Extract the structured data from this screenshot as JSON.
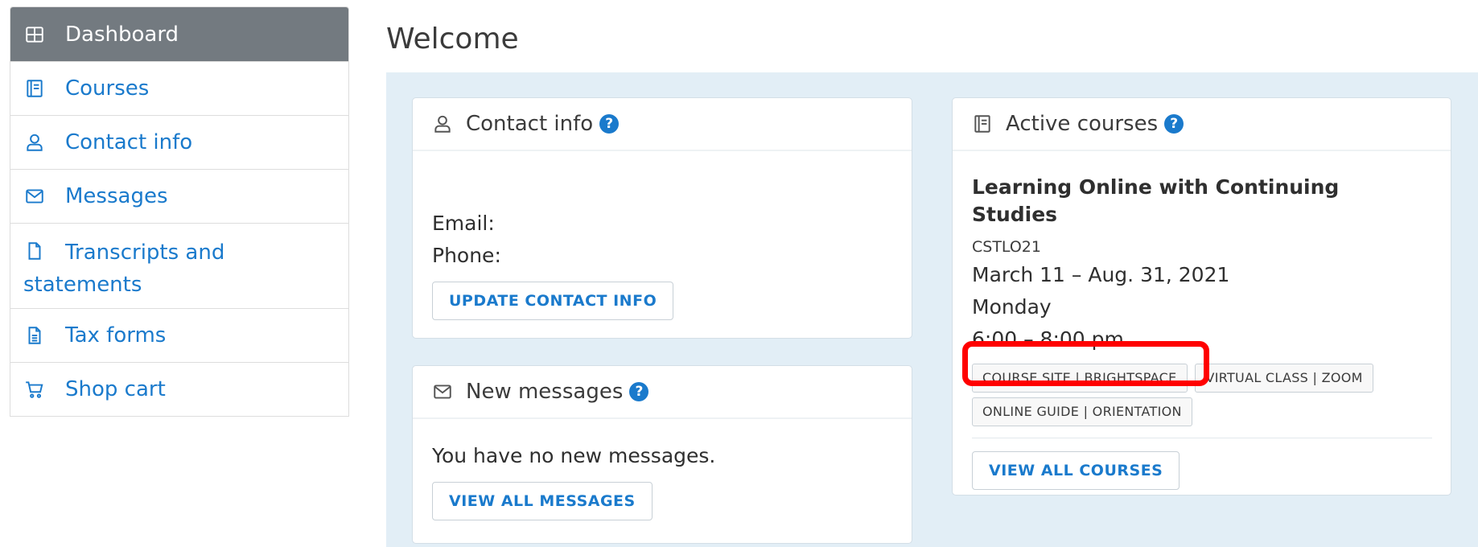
{
  "sidebar": {
    "items": [
      {
        "label": "Dashboard",
        "icon": "grid-icon",
        "active": true
      },
      {
        "label": "Courses",
        "icon": "book-icon"
      },
      {
        "label": "Contact info",
        "icon": "person-icon"
      },
      {
        "label": "Messages",
        "icon": "envelope-icon"
      },
      {
        "label": "Transcripts and statements",
        "icon": "document-icon"
      },
      {
        "label": "Tax forms",
        "icon": "form-icon"
      },
      {
        "label": "Shop cart",
        "icon": "cart-icon"
      }
    ]
  },
  "main": {
    "title": "Welcome",
    "contact_card": {
      "title": "Contact info",
      "help": "?",
      "email_label": "Email:",
      "phone_label": "Phone:",
      "button": "UPDATE CONTACT INFO"
    },
    "messages_card": {
      "title": "New messages",
      "help": "?",
      "text": "You have no new messages.",
      "button": "VIEW ALL MESSAGES"
    },
    "courses_card": {
      "title": "Active courses",
      "help": "?",
      "course": {
        "name": "Learning Online with Continuing Studies",
        "code": "CSTLO21",
        "dates": "March 11 – Aug. 31, 2021",
        "day": "Monday",
        "time": "6:00 – 8:00 pm",
        "tags": [
          "COURSE SITE | BRIGHTSPACE",
          "VIRTUAL CLASS | ZOOM",
          "ONLINE GUIDE | ORIENTATION"
        ]
      },
      "button": "VIEW ALL COURSES"
    }
  },
  "colors": {
    "accent": "#1a7acc",
    "sidebar_active": "#737a80",
    "panel_bg": "#e2eef6",
    "highlight": "#ff0000"
  }
}
